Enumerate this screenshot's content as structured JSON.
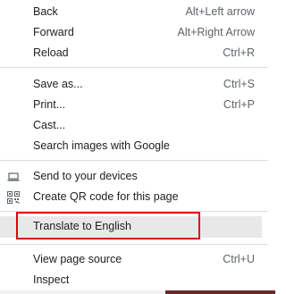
{
  "menu": {
    "back": {
      "label": "Back",
      "shortcut": "Alt+Left arrow"
    },
    "forward": {
      "label": "Forward",
      "shortcut": "Alt+Right Arrow"
    },
    "reload": {
      "label": "Reload",
      "shortcut": "Ctrl+R"
    },
    "save_as": {
      "label": "Save as...",
      "shortcut": "Ctrl+S"
    },
    "print": {
      "label": "Print...",
      "shortcut": "Ctrl+P"
    },
    "cast": {
      "label": "Cast..."
    },
    "search_images": {
      "label": "Search images with Google"
    },
    "send_to_devices": {
      "label": "Send to your devices",
      "icon": "laptop-icon"
    },
    "create_qr": {
      "label": "Create QR code for this page",
      "icon": "qr-code-icon"
    },
    "translate": {
      "label": "Translate to English"
    },
    "view_source": {
      "label": "View page source",
      "shortcut": "Ctrl+U"
    },
    "inspect": {
      "label": "Inspect"
    }
  },
  "colors": {
    "highlight_box": "#e3000f",
    "hover_background": "#e8e8e8"
  }
}
